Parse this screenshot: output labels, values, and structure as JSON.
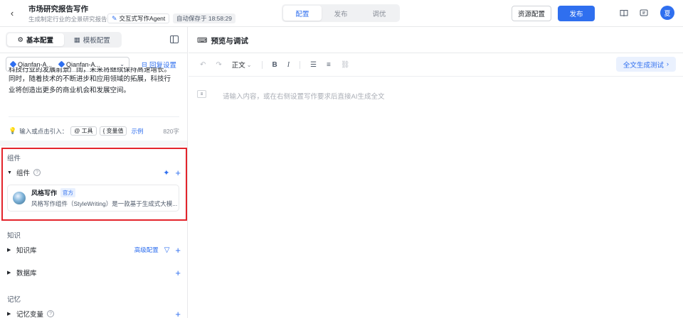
{
  "header": {
    "title": "市场研究报告写作",
    "subtitle": "生成制定行业的全景研究报告",
    "agent_tag": "交互式写作Agent",
    "save_status": "自动保存于 18:58:29",
    "tabs": [
      "配置",
      "发布",
      "调优"
    ],
    "resource_config": "资源配置",
    "publish": "发布",
    "avatar_initial": "夏"
  },
  "left": {
    "tabs": [
      "基本配置",
      "模板配置"
    ],
    "models": [
      "Qianfan-A...",
      "Qianfan-A..."
    ],
    "reply_settings": "回复设置",
    "prompt_cut": "科技行业的发展前景广阔，未来将继续保持高速增长。",
    "prompt_lines": [
      "同时，随着技术的不断进步和应用领域的拓展，科技行",
      "业将创造出更多的商业机会和发展空间。"
    ],
    "hint_label": "输入或点击引入：",
    "chip_tool": "@ 工具",
    "chip_var": "{ 变量值",
    "example": "示例",
    "char_count": "820字",
    "sections": {
      "components_title": "组件",
      "components_group": "组件",
      "component": {
        "name": "风格写作",
        "badge": "官方",
        "desc": "风格写作组件（StyleWriting）是一款基于生成式大模..."
      },
      "knowledge_title": "知识",
      "kb_label": "知识库",
      "kb_advanced": "高级配置",
      "db_label": "数据库",
      "memory_title": "记忆",
      "memory_var": "记忆变量"
    }
  },
  "right": {
    "preview_title": "预览与调试",
    "text_style": "正文",
    "full_test": "全文生成测试",
    "placeholder": "请输入内容，或在右侧设置写作要求后直接AI生成全文"
  }
}
